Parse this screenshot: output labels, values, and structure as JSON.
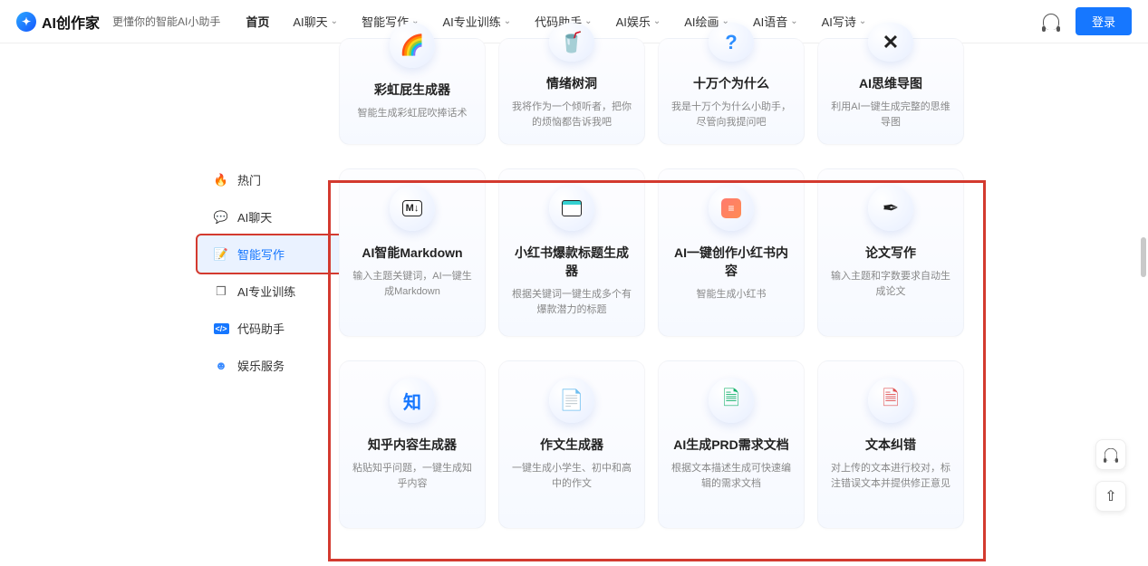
{
  "brand": {
    "name": "AI创作家",
    "tagline": "更懂你的智能AI小助手"
  },
  "nav": {
    "items": [
      {
        "label": "首页",
        "dropdown": false
      },
      {
        "label": "AI聊天",
        "dropdown": true
      },
      {
        "label": "智能写作",
        "dropdown": true
      },
      {
        "label": "AI专业训练",
        "dropdown": true
      },
      {
        "label": "代码助手",
        "dropdown": true
      },
      {
        "label": "AI娱乐",
        "dropdown": true
      },
      {
        "label": "AI绘画",
        "dropdown": true
      },
      {
        "label": "AI语音",
        "dropdown": true
      },
      {
        "label": "AI写诗",
        "dropdown": true
      }
    ],
    "login": "登录"
  },
  "sidebar": {
    "items": [
      {
        "label": "热门"
      },
      {
        "label": "AI聊天"
      },
      {
        "label": "智能写作"
      },
      {
        "label": "AI专业训练"
      },
      {
        "label": "代码助手"
      },
      {
        "label": "娱乐服务"
      }
    ],
    "active_index": 2
  },
  "cards_top": [
    {
      "title": "彩虹屁生成器",
      "desc": "智能生成彩虹屁吹捧话术"
    },
    {
      "title": "情绪树洞",
      "desc": "我将作为一个倾听者，把你的烦恼都告诉我吧"
    },
    {
      "title": "十万个为什么",
      "desc": "我是十万个为什么小助手，尽管向我提问吧"
    },
    {
      "title": "AI思维导图",
      "desc": "利用AI一键生成完整的思维导图"
    }
  ],
  "cards_mid": [
    {
      "title": "AI智能Markdown",
      "desc": "输入主题关键词，AI一键生成Markdown"
    },
    {
      "title": "小红书爆款标题生成器",
      "desc": "根据关键词一键生成多个有爆款潜力的标题"
    },
    {
      "title": "AI一键创作小红书内容",
      "desc": "智能生成小红书"
    },
    {
      "title": "论文写作",
      "desc": "输入主题和字数要求自动生成论文"
    }
  ],
  "cards_bot": [
    {
      "title": "知乎内容生成器",
      "desc": "粘贴知乎问题，一键生成知乎内容"
    },
    {
      "title": "作文生成器",
      "desc": "一键生成小学生、初中和高中的作文"
    },
    {
      "title": "AI生成PRD需求文档",
      "desc": "根据文本描述生成可快速编辑的需求文档"
    },
    {
      "title": "文本纠错",
      "desc": "对上传的文本进行校对，标注错误文本并提供修正意见"
    }
  ]
}
